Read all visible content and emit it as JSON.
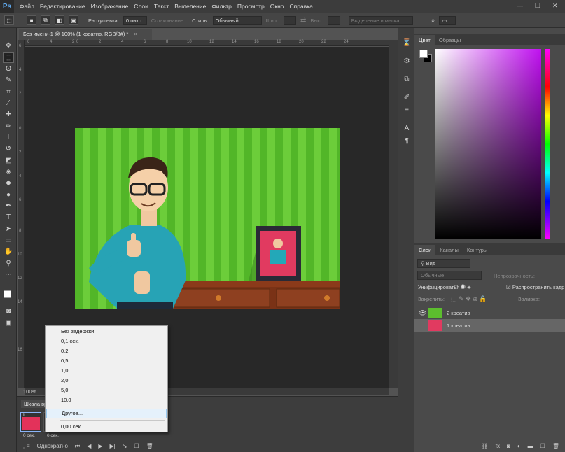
{
  "app": {
    "logo": "Ps"
  },
  "menu": [
    "Файл",
    "Редактирование",
    "Изображение",
    "Слои",
    "Текст",
    "Выделение",
    "Фильтр",
    "Просмотр",
    "Окно",
    "Справка"
  ],
  "options": {
    "feather_label": "Растушевка:",
    "feather_value": "0 пикс.",
    "antialias_label": "Сглаживание",
    "style_label": "Стиль:",
    "style_value": "Обычный",
    "width_label": "Шир.:",
    "height_label": "Выс.:",
    "refine_button": "Выделение и маска..."
  },
  "document": {
    "tab_title": "Без имени-1 @ 100% (1 креатив, RGB/8#) *",
    "zoom": "100%"
  },
  "rulers": {
    "h": [
      "6",
      "4",
      "2",
      "0",
      "2",
      "4",
      "6",
      "8",
      "10",
      "12",
      "14",
      "16",
      "18",
      "20",
      "22",
      "24"
    ],
    "v": [
      "6",
      "4",
      "2",
      "0",
      "2",
      "4",
      "6",
      "8",
      "10",
      "12",
      "14",
      "16"
    ]
  },
  "timeline": {
    "title": "Шкала времени",
    "frames": [
      {
        "num": "1",
        "delay": "0 сек."
      },
      {
        "num": "2",
        "delay": "0 сек."
      }
    ],
    "loop": "Однократно"
  },
  "delay_menu": {
    "items": [
      "Без задержки",
      "0,1 сек.",
      "0,2",
      "0,5",
      "1,0",
      "2,0",
      "5,0",
      "10,0"
    ],
    "other": "Другое...",
    "current": "0,00 сек."
  },
  "color_panel": {
    "tabs": [
      "Цвет",
      "Образцы"
    ],
    "fg": "#ffffff",
    "bg": "#000000",
    "hue": "#c010f0"
  },
  "layers_panel": {
    "tabs": [
      "Слои",
      "Каналы",
      "Контуры"
    ],
    "filter": "Вид",
    "blend_mode": "Обычные",
    "opacity_label": "Непрозрачность:",
    "unify_label": "Унифицировать:",
    "propagate_label": "Распространить кадр 1",
    "lock_label": "Закрепить:",
    "fill_label": "Заливка:",
    "layers": [
      {
        "name": "2 креатив",
        "visible": true,
        "selected": false
      },
      {
        "name": "1 креатив",
        "visible": false,
        "selected": true
      }
    ]
  },
  "icons": {
    "tools": [
      "move-icon",
      "marquee-icon",
      "lasso-icon",
      "quick-select-icon",
      "crop-icon",
      "eyedropper-icon",
      "healing-icon",
      "brush-icon",
      "stamp-icon",
      "history-brush-icon",
      "eraser-icon",
      "gradient-icon",
      "blur-icon",
      "dodge-icon",
      "pen-icon",
      "type-icon",
      "path-select-icon",
      "rectangle-icon",
      "hand-icon",
      "zoom-icon",
      "more-tools-icon"
    ]
  }
}
